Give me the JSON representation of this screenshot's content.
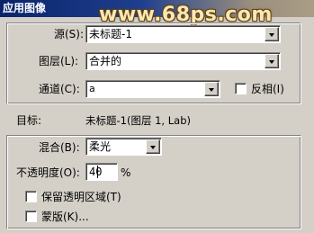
{
  "window": {
    "title": "应用图像"
  },
  "watermark": "www.68ps.com",
  "source_section": {
    "source": {
      "label": "源(S):",
      "value": "未标题-1"
    },
    "layer": {
      "label": "图层(L):",
      "value": "合并的"
    },
    "channel": {
      "label": "通道(C):",
      "value": "a"
    },
    "invert": {
      "label": "反相(I)",
      "checked": false
    }
  },
  "target": {
    "label": "目标:",
    "value": "未标题-1(图层 1, Lab)"
  },
  "blend_section": {
    "blending": {
      "label": "混合(B):",
      "value": "柔光"
    },
    "opacity": {
      "label": "不透明度(O):",
      "value": "40",
      "unit": "%"
    },
    "preserve_transparency": {
      "label": "保留透明区域(T)",
      "checked": false
    },
    "mask": {
      "label": "蒙版(K)...",
      "checked": false
    }
  }
}
